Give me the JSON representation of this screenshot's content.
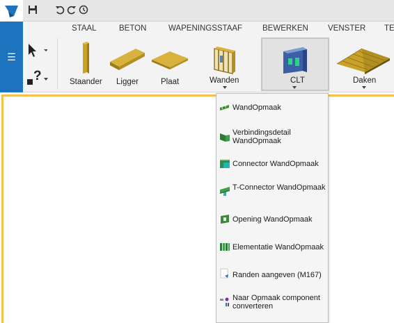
{
  "ribbon_tabs": [
    "STAAL",
    "BETON",
    "WAPENINGSSTAAF",
    "BEWERKEN",
    "VENSTER",
    "TE"
  ],
  "tools": {
    "staander": "Staander",
    "ligger": "Ligger",
    "plaat": "Plaat",
    "wanden": "Wanden",
    "clt": "CLT",
    "daken": "Daken"
  },
  "small_tools": {
    "help": "?"
  },
  "dropdown": {
    "items": [
      {
        "label": "WandOpmaak",
        "icon": "wall-layout-icon"
      },
      {
        "label": "Verbindingsdetail WandOpmaak",
        "icon": "connection-detail-icon"
      },
      {
        "label": "Connector WandOpmaak",
        "icon": "connector-icon"
      },
      {
        "label": "T-Connector WandOpmaak",
        "icon": "t-connector-icon"
      },
      {
        "label": "Opening WandOpmaak",
        "icon": "opening-icon"
      },
      {
        "label": "Elementatie WandOpmaak",
        "icon": "elementation-icon"
      },
      {
        "label": "Randen aangeven (M167)",
        "icon": "edges-icon"
      },
      {
        "label": "Naar Opmaak component converteren",
        "icon": "convert-component-icon"
      }
    ]
  },
  "colors": {
    "accent": "#1e73be",
    "canvas_border": "#f2c14e",
    "wood": "#c9a227"
  }
}
